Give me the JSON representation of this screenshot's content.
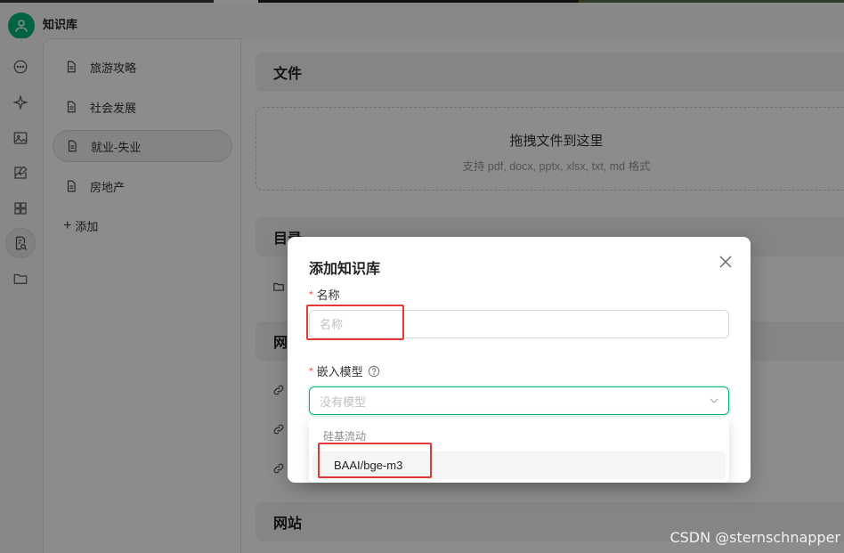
{
  "app": {
    "title": "知识库",
    "brand_color": "#00b578"
  },
  "icon_rail": [
    {
      "name": "chat-icon"
    },
    {
      "name": "sparkle-icon"
    },
    {
      "name": "image-icon"
    },
    {
      "name": "image-edit-icon"
    },
    {
      "name": "apps-grid-icon"
    },
    {
      "name": "knowledge-base-icon",
      "active": true
    },
    {
      "name": "folder-icon"
    }
  ],
  "sidebar": {
    "items": [
      {
        "label": "旅游攻略"
      },
      {
        "label": "社会发展"
      },
      {
        "label": "就业-失业",
        "selected": true
      },
      {
        "label": "房地产"
      }
    ],
    "add_label": "添加"
  },
  "main": {
    "files_section": "文件",
    "dropzone_title": "拖拽文件到这里",
    "dropzone_subtitle": "支持 pdf, docx, pptx, xlsx, txt, md 格式",
    "directory_section": "目录",
    "web_section_partial": "网",
    "website_section": "网站"
  },
  "modal": {
    "title": "添加知识库",
    "name_label": "名称",
    "name_placeholder": "名称",
    "name_value": "",
    "model_label": "嵌入模型",
    "model_placeholder": "没有模型",
    "dropdown": {
      "group_label": "硅基流动",
      "options": [
        "BAAI/bge-m3"
      ]
    }
  },
  "watermark": "CSDN @sternschnapper"
}
